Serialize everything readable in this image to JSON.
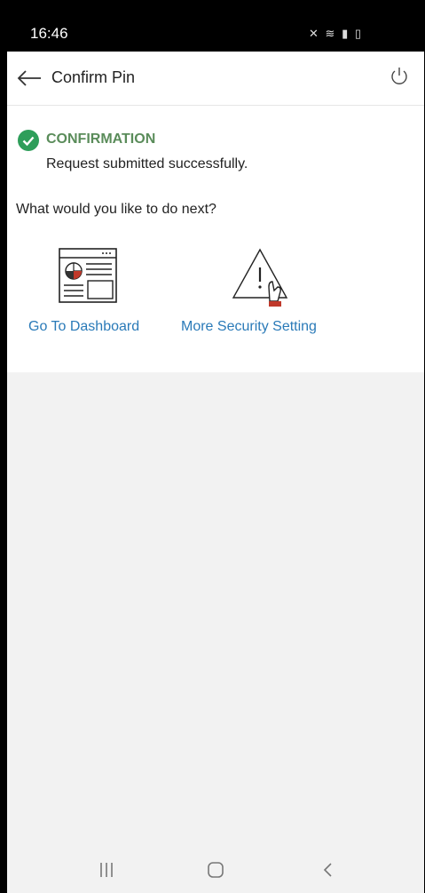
{
  "status_bar": {
    "time": "16:46",
    "icons": [
      "mute-icon",
      "wifi-icon",
      "signal-icon",
      "battery-icon"
    ]
  },
  "app_bar": {
    "title": "Confirm Pin",
    "back_icon": "arrow-left-icon",
    "power_icon": "power-icon"
  },
  "confirmation": {
    "heading": "CONFIRMATION",
    "message": "Request submitted successfully.",
    "status_color": "#2e9e5a",
    "heading_color": "#5a8c5a"
  },
  "next_steps": {
    "question": "What would you like to do next?",
    "actions": [
      {
        "label": "Go To Dashboard",
        "icon": "dashboard-icon"
      },
      {
        "label": "More Security Setting",
        "icon": "security-warning-icon"
      }
    ],
    "link_color": "#2a7ab8"
  },
  "nav_bar": {
    "buttons": [
      "recent-apps-icon",
      "home-icon",
      "back-icon"
    ]
  }
}
